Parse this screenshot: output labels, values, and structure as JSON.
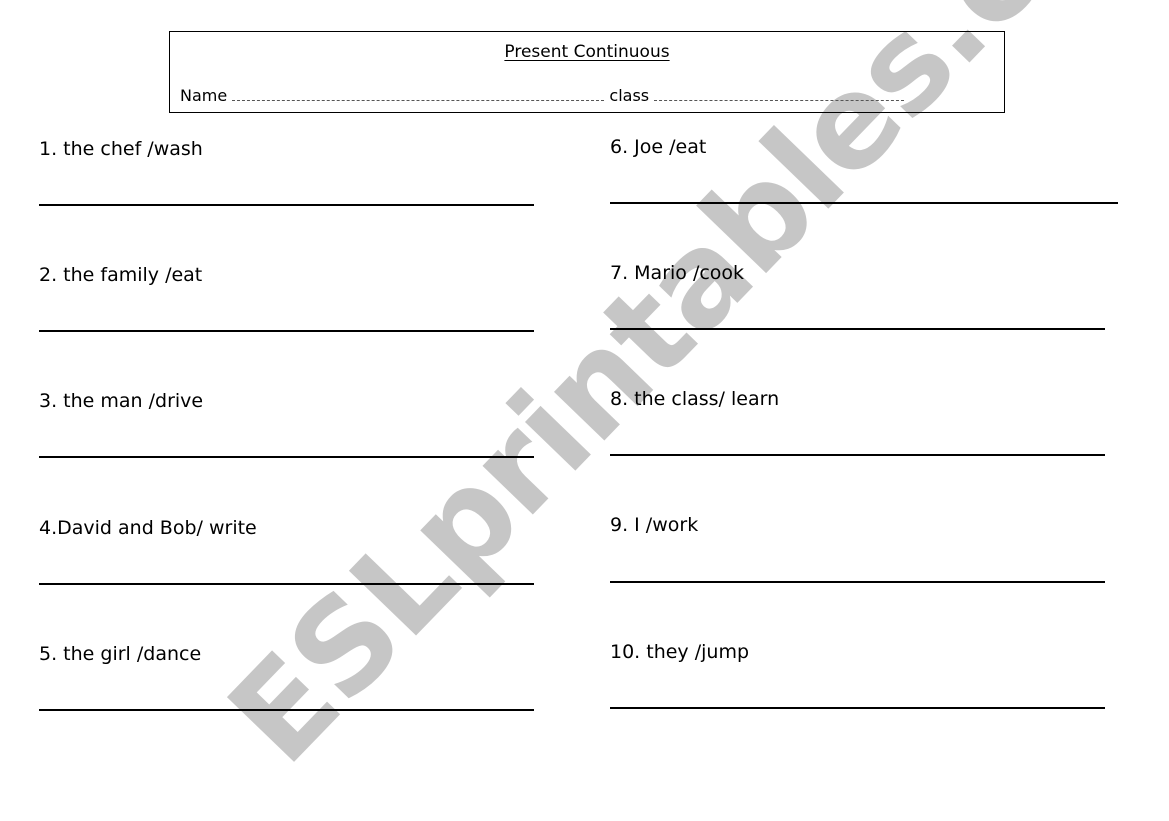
{
  "worksheet": {
    "title": "Present Continuous",
    "name_label": "Name",
    "class_label": "class",
    "watermark": "ESLprintables.com"
  },
  "questions_left": [
    {
      "text": "1. the chef /wash"
    },
    {
      "text": "2. the family /eat"
    },
    {
      "text": "3. the man /drive"
    },
    {
      "text": "4.David and Bob/ write"
    },
    {
      "text": "5. the girl /dance"
    }
  ],
  "questions_right": [
    {
      "text": "6. Joe /eat"
    },
    {
      "text": "7. Mario /cook"
    },
    {
      "text": "8. the class/ learn"
    },
    {
      "text": "9. I /work"
    },
    {
      "text": "10. they /jump"
    }
  ]
}
